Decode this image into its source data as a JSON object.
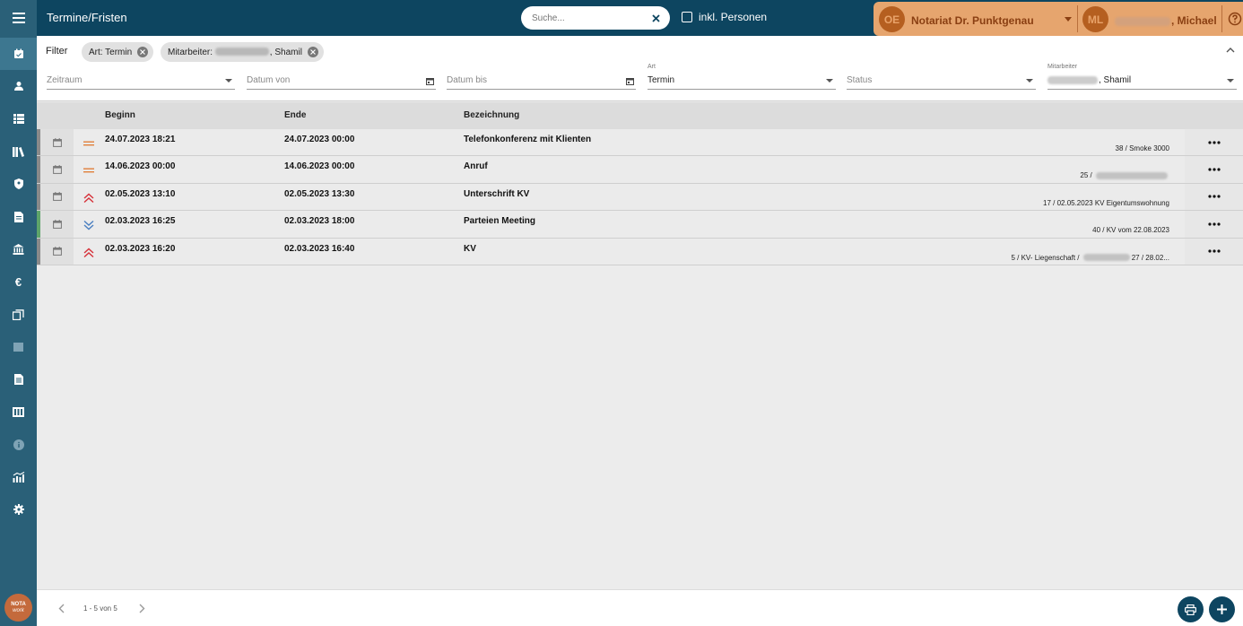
{
  "app": {
    "title": "Termine/Fristen"
  },
  "search": {
    "placeholder": "Suche..."
  },
  "persons": {
    "label": "inkl. Personen",
    "checked": false
  },
  "office": {
    "initials": "OE",
    "name": "Notariat Dr. Punktgenau"
  },
  "user": {
    "initials": "ML",
    "name": ", Michael"
  },
  "sidebar": {
    "items": [
      {
        "icon": "calendar-check-icon",
        "active": true
      },
      {
        "icon": "person-icon"
      },
      {
        "icon": "list-icon"
      },
      {
        "icon": "books-icon"
      },
      {
        "icon": "lock-person-icon"
      },
      {
        "icon": "document-icon"
      },
      {
        "icon": "bank-icon"
      },
      {
        "icon": "euro-icon"
      },
      {
        "icon": "copy-icon"
      },
      {
        "icon": "square-icon"
      },
      {
        "icon": "file-text-icon"
      },
      {
        "icon": "register-icon"
      },
      {
        "icon": "info-icon"
      },
      {
        "icon": "chart-icon"
      },
      {
        "icon": "gear-icon"
      }
    ],
    "logo_top": "NOTA",
    "logo_bottom": "work"
  },
  "filter": {
    "label": "Filter",
    "chips": [
      {
        "text": "Art: Termin"
      },
      {
        "prefix": "Mitarbeiter: ",
        "suffix": ", Shamil"
      }
    ],
    "fields": {
      "zeitraum": {
        "placeholder": "Zeitraum"
      },
      "datum_von": {
        "placeholder": "Datum von"
      },
      "datum_bis": {
        "placeholder": "Datum bis"
      },
      "art": {
        "label": "Art",
        "value": "Termin"
      },
      "status": {
        "placeholder": "Status"
      },
      "mitarbeiter": {
        "label": "Mitarbeiter",
        "value": ", Shamil"
      }
    }
  },
  "table": {
    "headers": {
      "begin": "Beginn",
      "end": "Ende",
      "name": "Bezeichnung"
    },
    "rows": [
      {
        "begin": "24.07.2023 18:21",
        "end": "24.07.2023 00:00",
        "name": "Telefonkonferenz mit Klienten",
        "sub": "38 / Smoke 3000",
        "priority": "normal",
        "stripe": "grey"
      },
      {
        "begin": "14.06.2023 00:00",
        "end": "14.06.2023 00:00",
        "name": "Anruf",
        "sub_prefix": "25 / ",
        "sub_suffix": "",
        "priority": "normal",
        "stripe": "grey"
      },
      {
        "begin": "02.05.2023 13:10",
        "end": "02.05.2023 13:30",
        "name": "Unterschrift KV",
        "sub": "17 / 02.05.2023 KV Eigentumswohnung",
        "priority": "high",
        "stripe": "grey"
      },
      {
        "begin": "02.03.2023 16:25",
        "end": "02.03.2023 18:00",
        "name": "Parteien Meeting",
        "sub": "40 / KV vom 22.08.2023",
        "priority": "low",
        "stripe": "green"
      },
      {
        "begin": "02.03.2023 16:20",
        "end": "02.03.2023 16:40",
        "name": "KV",
        "sub_prefix": "5 / KV- Liegenschaft / ",
        "sub_suffix": "27 / 28.02...",
        "priority": "high",
        "stripe": "grey"
      }
    ]
  },
  "pagination": {
    "text": "1 - 5 von 5"
  },
  "colors": {
    "primary": "#0d4560",
    "sidebar": "#2a6078",
    "accent": "#e6a56e",
    "prio_high": "#d6313a",
    "prio_normal": "#e0803c",
    "prio_low": "#4a7fc0"
  }
}
